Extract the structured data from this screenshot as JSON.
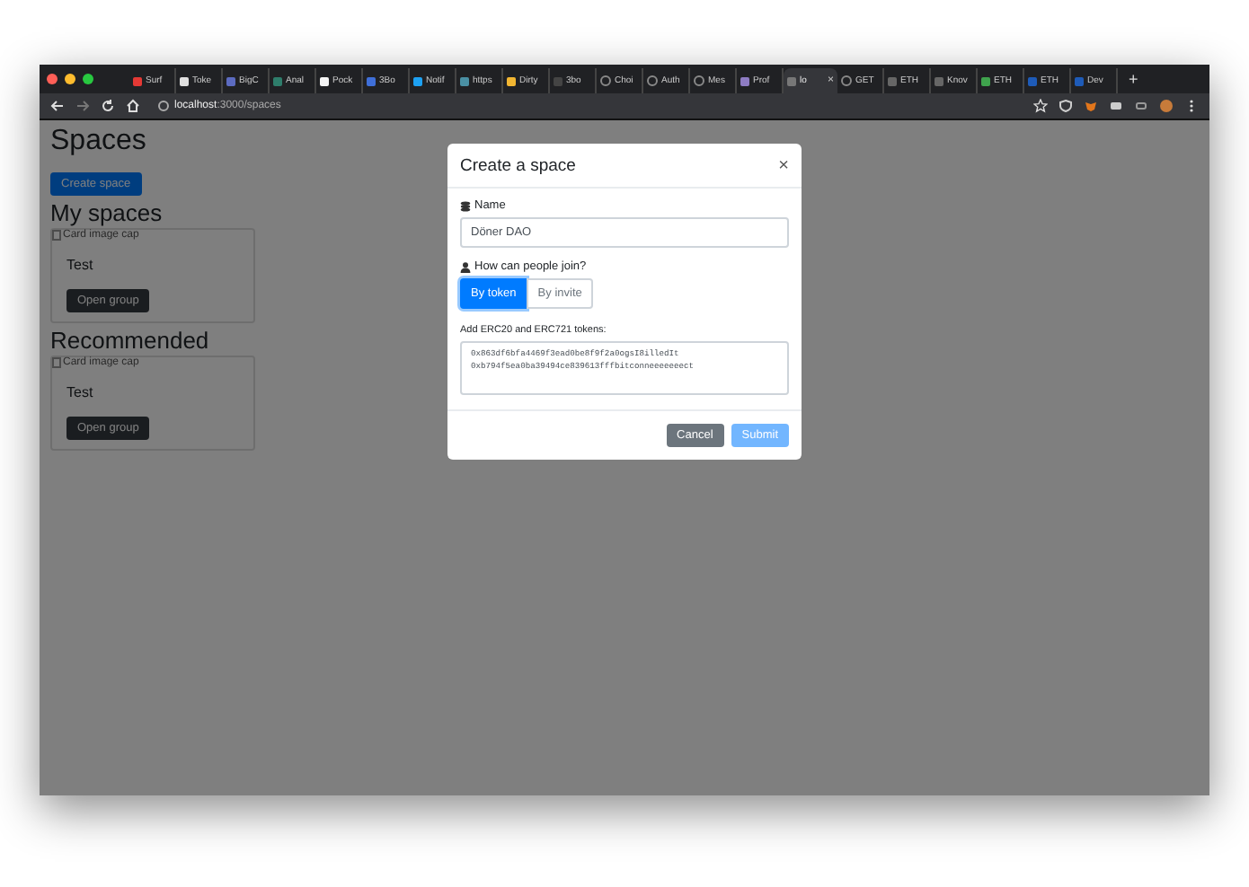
{
  "browser": {
    "tabs": [
      {
        "label": "Surf",
        "selected": false,
        "color": "#e53935"
      },
      {
        "label": "Toke",
        "selected": false,
        "color": "#e0e0e0"
      },
      {
        "label": "BigC",
        "selected": false,
        "color": "#5c6bc0"
      },
      {
        "label": "Anal",
        "selected": false,
        "color": "#2e7d6b"
      },
      {
        "label": "Pock",
        "selected": false,
        "color": "#f5f5f5"
      },
      {
        "label": "3Bo",
        "selected": false,
        "color": "#3f6fd8"
      },
      {
        "label": "Notif",
        "selected": false,
        "color": "#1da1f2"
      },
      {
        "label": "https",
        "selected": false,
        "color": "#4a90a4"
      },
      {
        "label": "Dirty",
        "selected": false,
        "color": "#f2b632"
      },
      {
        "label": "3bo",
        "selected": false,
        "color": "#444444"
      },
      {
        "label": "Choi",
        "selected": false
      },
      {
        "label": "Auth",
        "selected": false
      },
      {
        "label": "Mes",
        "selected": false
      },
      {
        "label": "Prof",
        "selected": false,
        "color": "#8e7cc3"
      },
      {
        "label": "lo",
        "selected": true,
        "color": "#777777"
      },
      {
        "label": "GET",
        "selected": false
      },
      {
        "label": "ETH",
        "selected": false,
        "color": "#666666"
      },
      {
        "label": "Knov",
        "selected": false,
        "color": "#666666"
      },
      {
        "label": "ETH",
        "selected": false,
        "color": "#3fa34d"
      },
      {
        "label": "ETH",
        "selected": false,
        "color": "#1e5bb8"
      },
      {
        "label": "Dev",
        "selected": false,
        "color": "#1e5bb8"
      }
    ],
    "new_tab": "+",
    "close_tab": "×",
    "url_host": "localhost",
    "url_path": ":3000/spaces"
  },
  "page": {
    "title": "Spaces",
    "create_button": "Create space",
    "sections": [
      {
        "heading": "My spaces",
        "cards": [
          {
            "image_alt": "Card image cap",
            "title": "Test",
            "button": "Open group"
          }
        ]
      },
      {
        "heading": "Recommended",
        "cards": [
          {
            "image_alt": "Card image cap",
            "title": "Test",
            "button": "Open group"
          }
        ]
      }
    ]
  },
  "modal": {
    "title": "Create a space",
    "close": "×",
    "name_label": "Name",
    "name_value": "Döner DAO",
    "join_label": "How can people join?",
    "join_options": [
      {
        "label": "By token",
        "selected": true
      },
      {
        "label": "By invite",
        "selected": false
      }
    ],
    "tokens_label": "Add ERC20 and ERC721 tokens:",
    "tokens_value": "0x863df6bfa4469f3ead0be8f9f2a0ogsI8illedIt\n0xb794f5ea0ba39494ce839613fffbitconneeeeeeect",
    "buttons": [
      {
        "label": "Cancel",
        "kind": "secondary",
        "disabled": false
      },
      {
        "label": "Submit",
        "kind": "primary",
        "disabled": true
      }
    ]
  }
}
